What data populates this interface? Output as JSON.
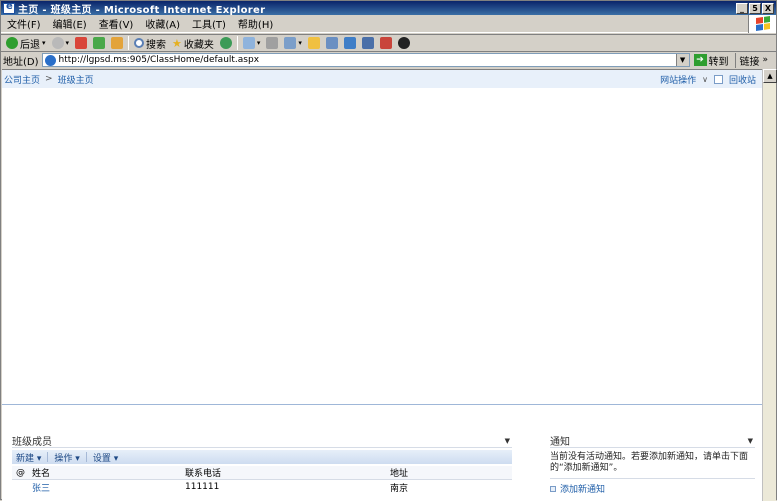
{
  "window": {
    "title": "主页 - 班级主页 - Microsoft Internet Explorer",
    "controls": [
      "_",
      "5",
      "X"
    ]
  },
  "menubar": {
    "items": [
      "文件(F)",
      "编辑(E)",
      "查看(V)",
      "收藏(A)",
      "工具(T)",
      "帮助(H)"
    ]
  },
  "toolbar": {
    "back_label": "后退",
    "search_label": "搜索",
    "favorites_label": "收藏夹"
  },
  "addressbar": {
    "label": "地址(D)",
    "url": "http://lgpsd.ms:905/ClassHome/default.aspx",
    "go_label": "转到",
    "links_label": "链接"
  },
  "page": {
    "breadcrumb": [
      "公司主页",
      "班级主页"
    ],
    "site_actions_label": "网站操作",
    "my_site_label": "回收站"
  },
  "members_webpart": {
    "title": "班级成员",
    "toolbar": {
      "new_label": "新建",
      "actions_label": "操作",
      "settings_label": "设置"
    },
    "columns": [
      "姓名",
      "联系电话",
      "地址"
    ],
    "rows": [
      {
        "name": "张三",
        "phone": "111111",
        "address": "南京"
      }
    ]
  },
  "notice_webpart": {
    "title": "通知",
    "empty_text": "当前没有活动通知。若要添加新通知，请单击下面的“添加新通知”。",
    "add_link": "添加新通知"
  },
  "colors": {
    "titlebar_start": "#0a246a",
    "titlebar_end": "#3a6ea5",
    "link_blue": "#1f5ea8",
    "sharepoint_band": "#e8f0fa"
  }
}
